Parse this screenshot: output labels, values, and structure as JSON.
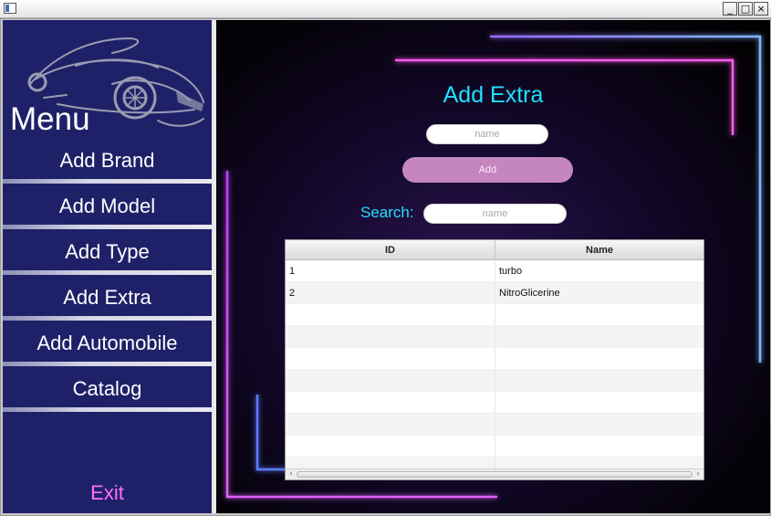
{
  "window": {
    "minimize_glyph": "_",
    "maximize_glyph": "□",
    "close_glyph": "×"
  },
  "sidebar": {
    "menu_title": "Menu",
    "items": [
      {
        "label": "Add Brand"
      },
      {
        "label": "Add Model"
      },
      {
        "label": "Add Type"
      },
      {
        "label": "Add Extra"
      },
      {
        "label": "Add Automobile"
      },
      {
        "label": "Catalog"
      }
    ],
    "exit_label": "Exit",
    "logo_icon": "sports-car-icon"
  },
  "main": {
    "title": "Add Extra",
    "name_input": {
      "value": "",
      "placeholder": "name"
    },
    "add_button_label": "Add",
    "search_label": "Search:",
    "search_input": {
      "value": "",
      "placeholder": "name"
    },
    "table": {
      "columns": [
        "ID",
        "Name"
      ],
      "rows": [
        {
          "id": "1",
          "name": "turbo"
        },
        {
          "id": "2",
          "name": "NitroGlicerine"
        },
        {
          "id": "",
          "name": ""
        },
        {
          "id": "",
          "name": ""
        },
        {
          "id": "",
          "name": ""
        },
        {
          "id": "",
          "name": ""
        },
        {
          "id": "",
          "name": ""
        },
        {
          "id": "",
          "name": ""
        },
        {
          "id": "",
          "name": ""
        },
        {
          "id": "",
          "name": ""
        }
      ]
    }
  },
  "colors": {
    "sidebar_bg": "#1f2168",
    "accent_cyan": "#22e0ff",
    "exit_pink": "#ff6fff",
    "add_button": "#c586c0"
  }
}
